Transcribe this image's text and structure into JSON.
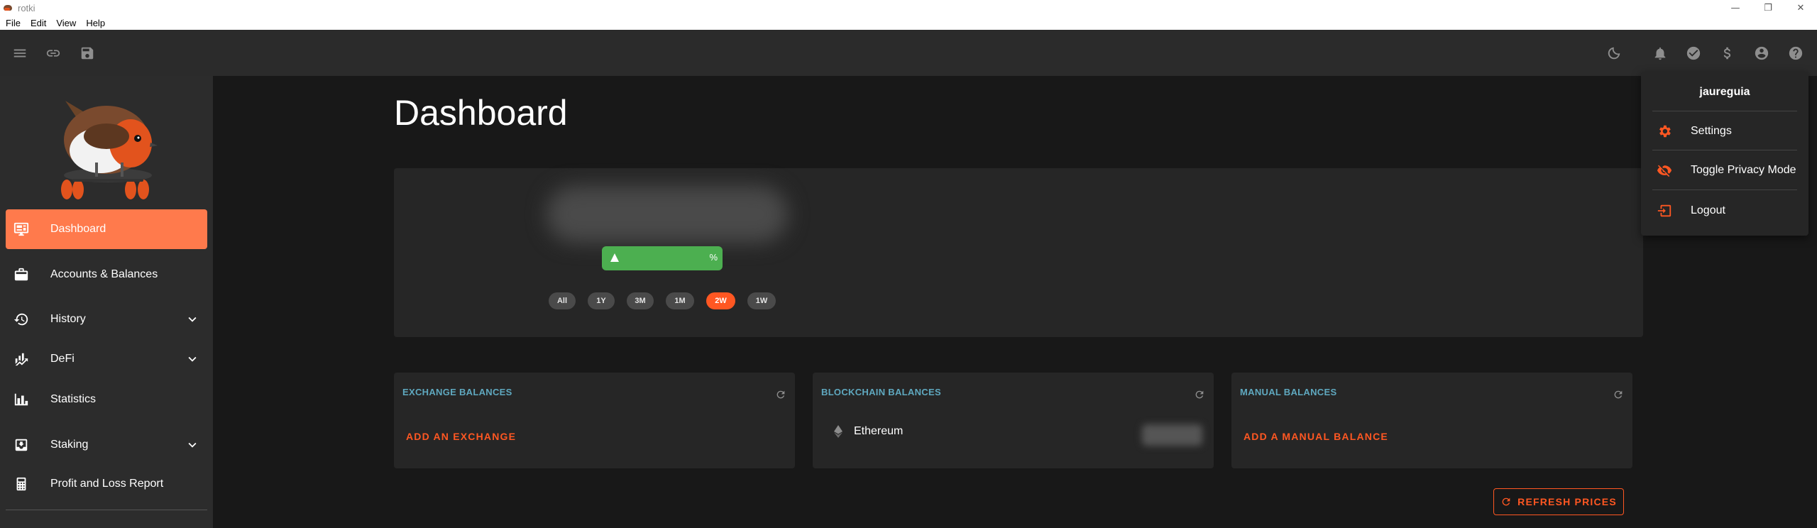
{
  "window": {
    "title": "rotki",
    "controls": [
      "—",
      "❐",
      "✕"
    ]
  },
  "menubar": [
    "File",
    "Edit",
    "View",
    "Help"
  ],
  "toolbar": {
    "left_icons": [
      "menu-icon",
      "link-icon",
      "save-icon"
    ],
    "right_icons": [
      "theme-toggle-icon",
      "notifications-icon",
      "sync-status-icon",
      "currency-icon",
      "account-icon",
      "help-icon"
    ]
  },
  "sidebar": {
    "items": [
      {
        "label": "Dashboard",
        "icon": "monitor-dashboard-icon",
        "active": true
      },
      {
        "label": "Accounts & Balances",
        "icon": "briefcase-icon"
      },
      {
        "label": "History",
        "icon": "history-icon",
        "expandable": true
      },
      {
        "label": "DeFi",
        "icon": "finance-icon",
        "expandable": true
      },
      {
        "label": "Statistics",
        "icon": "chart-bar-icon"
      },
      {
        "label": "Staking",
        "icon": "inbox-arrow-icon",
        "expandable": true
      },
      {
        "label": "Profit and Loss Report",
        "icon": "calculator-icon"
      }
    ]
  },
  "main": {
    "title": "Dashboard",
    "overview": {
      "percent_suffix": "%",
      "timeframes": [
        "All",
        "1Y",
        "3M",
        "1M",
        "2W",
        "1W"
      ],
      "active_timeframe": "2W"
    },
    "cards": {
      "exchange": {
        "title": "EXCHANGE BALANCES",
        "link": "ADD AN EXCHANGE"
      },
      "blockchain": {
        "title": "BLOCKCHAIN BALANCES",
        "chain": "Ethereum"
      },
      "manual": {
        "title": "MANUAL BALANCES",
        "link": "ADD A MANUAL BALANCE"
      }
    },
    "refresh_prices": "REFRESH PRICES"
  },
  "user_menu": {
    "username": "jaureguia",
    "items": [
      {
        "label": "Settings",
        "icon": "cog-icon"
      },
      {
        "label": "Toggle Privacy Mode",
        "icon": "eye-off-icon"
      },
      {
        "label": "Logout",
        "icon": "logout-icon"
      }
    ]
  },
  "colors": {
    "accent": "#ff5722",
    "active_nav": "#ff7a4c",
    "card_title": "#5fa8bf",
    "positive": "#4caf50"
  }
}
